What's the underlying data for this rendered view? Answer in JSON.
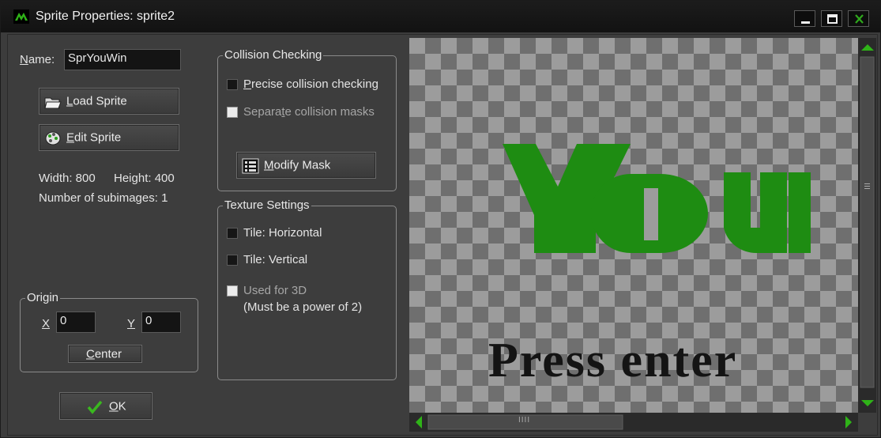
{
  "window": {
    "title": "Sprite Properties: sprite2",
    "controls": [
      "minimize-icon",
      "maximize-icon",
      "close-icon"
    ],
    "accent_color": "#1e8c12"
  },
  "name": {
    "label": "Name:",
    "value": "SprYouWin"
  },
  "buttons": {
    "load_sprite": "Load Sprite",
    "edit_sprite": "Edit Sprite",
    "modify_mask": "Modify Mask",
    "center": "Center",
    "ok": "OK"
  },
  "info": {
    "width_label": "Width: 800",
    "height_label": "Height: 400",
    "subimages": "Number of subimages: 1"
  },
  "origin": {
    "title": "Origin",
    "x_label": "X",
    "x_value": "0",
    "y_label": "Y",
    "y_value": "0"
  },
  "collision": {
    "title": "Collision Checking",
    "precise": "Precise collision checking",
    "separate": "Separate collision masks"
  },
  "texture": {
    "title": "Texture Settings",
    "tile_h": "Tile: Horizontal",
    "tile_v": "Tile: Vertical",
    "used_3d": "Used for 3D",
    "power2": "(Must be a power of 2)"
  },
  "preview": {
    "headline": "You",
    "subtext": "Press enter",
    "headline_color": "#1e8c12",
    "subtext_color": "#141414"
  },
  "scrollbars": {
    "grip": "IIII"
  }
}
